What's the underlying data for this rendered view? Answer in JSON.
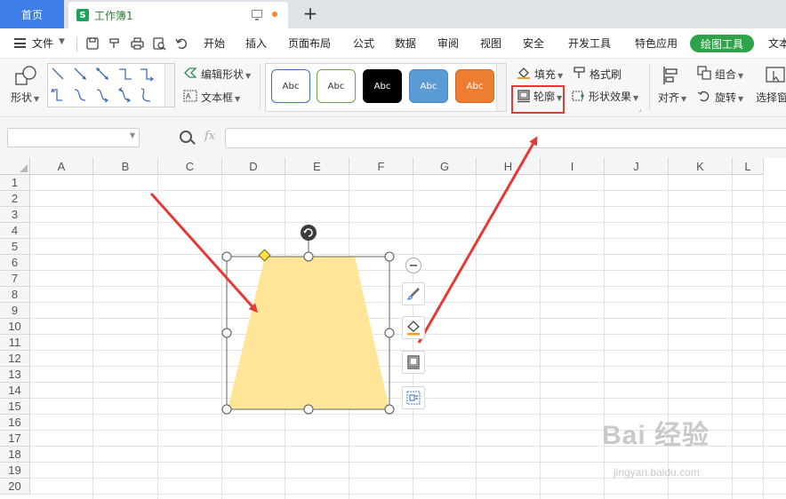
{
  "tabs": {
    "home": "首页",
    "workbook": "工作簿1",
    "new_tab": "+"
  },
  "menu": {
    "file": "文件",
    "items": [
      "开始",
      "插入",
      "页面布局",
      "公式",
      "数据",
      "审阅",
      "视图",
      "安全",
      "开发工具",
      "特色应用"
    ],
    "active_tab": "绘图工具",
    "overflow": "文本"
  },
  "ribbon": {
    "shape": "形状",
    "edit_shape": "编辑形状",
    "text_box": "文本框",
    "style_swatches": [
      {
        "label": "Abc",
        "fill": "#ffffff",
        "border": "#3d6fc8",
        "text": "#333333"
      },
      {
        "label": "Abc",
        "fill": "#ffffff",
        "border": "#6ba34b",
        "text": "#333333"
      },
      {
        "label": "Abc",
        "fill": "#000000",
        "border": "#000000",
        "text": "#ffffff"
      },
      {
        "label": "Abc",
        "fill": "#5b9bd5",
        "border": "#4a87c0",
        "text": "#ffffff"
      },
      {
        "label": "Abc",
        "fill": "#ed7d31",
        "border": "#d46a22",
        "text": "#ffffff"
      }
    ],
    "fill": "填充",
    "format_painter": "格式刷",
    "outline": "轮廓",
    "shape_effects": "形状效果",
    "align": "对齐",
    "group": "组合",
    "rotate": "旋转",
    "selection_pane": "选择窗"
  },
  "formula": {
    "fx": "fx",
    "name_box": "",
    "formula_value": ""
  },
  "grid": {
    "columns": [
      "A",
      "B",
      "C",
      "D",
      "E",
      "F",
      "G",
      "H",
      "I",
      "J",
      "K",
      "L"
    ],
    "rows": [
      "1",
      "2",
      "3",
      "4",
      "5",
      "6",
      "7",
      "8",
      "9",
      "10",
      "11",
      "12",
      "13",
      "14",
      "15",
      "16",
      "17",
      "18",
      "19",
      "20"
    ]
  },
  "shape": {
    "type": "trapezoid",
    "fill": "#ffe597",
    "selection_color": "#666666"
  },
  "annotation": {
    "arrow_color": "#e53935"
  },
  "watermark": {
    "text": "Bai 经验",
    "url": "jingyan.baidu.com"
  }
}
